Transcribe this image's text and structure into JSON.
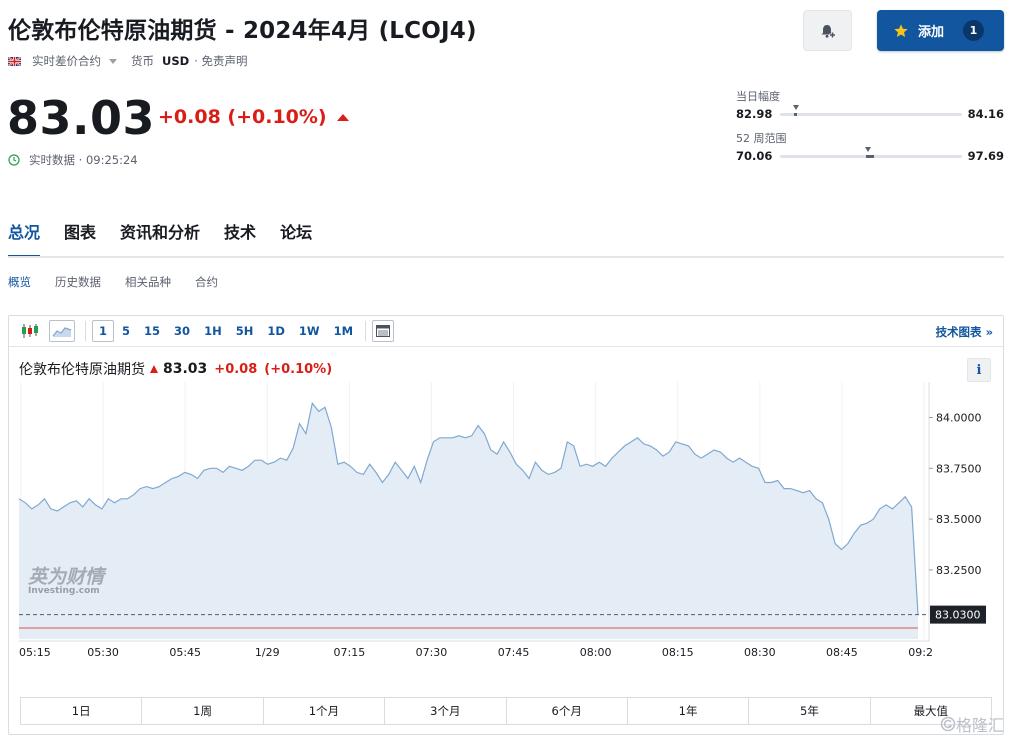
{
  "header": {
    "title": "伦敦布伦特原油期货 - 2024年4月 (LCOJ4)",
    "contract_type": "实时差价合约",
    "currency_label": "货币",
    "currency": "USD",
    "disclaimer": "· 免责声明",
    "alert_icon": "bell-plus-icon",
    "add_label": "添加",
    "add_count": "1"
  },
  "quote": {
    "price": "83.03",
    "change": "+0.08 (+0.10%)",
    "realtime_text": "实时数据 · 09:25:24"
  },
  "ranges": {
    "day_label": "当日幅度",
    "day_low": "82.98",
    "day_high": "84.16",
    "day_position": 0.04,
    "week52_label": "52 周范围",
    "week52_low": "70.06",
    "week52_high": "97.69",
    "week52_position": 0.47
  },
  "tabs": [
    "总况",
    "图表",
    "资讯和分析",
    "技术",
    "论坛"
  ],
  "subtabs": [
    "概览",
    "历史数据",
    "相关品种",
    "合约"
  ],
  "toolbar": {
    "intervals": [
      "1",
      "5",
      "15",
      "30",
      "1H",
      "5H",
      "1D",
      "1W",
      "1M"
    ],
    "active_interval": "1",
    "tech_chart_label": "技术图表 »"
  },
  "chart_header": {
    "name": "伦敦布伦特原油期货",
    "price": "83.03",
    "change": "+0.08",
    "change_pct": "(+0.10%)"
  },
  "chart_data": {
    "type": "area",
    "x_ticks": [
      "05:15",
      "05:30",
      "05:45",
      "1/29",
      "07:15",
      "07:30",
      "07:45",
      "08:00",
      "08:15",
      "08:30",
      "08:45",
      "09:2"
    ],
    "y_ticks": [
      "84.0000",
      "83.7500",
      "83.5000",
      "83.2500"
    ],
    "current_label": "83.0300",
    "ylim": [
      82.91,
      84.15
    ],
    "values": [
      83.6,
      83.58,
      83.55,
      83.57,
      83.6,
      83.55,
      83.54,
      83.56,
      83.58,
      83.59,
      83.56,
      83.6,
      83.57,
      83.55,
      83.6,
      83.58,
      83.6,
      83.6,
      83.62,
      83.65,
      83.66,
      83.65,
      83.66,
      83.68,
      83.7,
      83.71,
      83.73,
      83.72,
      83.7,
      83.74,
      83.75,
      83.75,
      83.73,
      83.76,
      83.75,
      83.74,
      83.76,
      83.79,
      83.79,
      83.77,
      83.78,
      83.8,
      83.79,
      83.85,
      83.97,
      83.92,
      84.07,
      84.03,
      84.05,
      83.95,
      83.77,
      83.78,
      83.76,
      83.73,
      83.72,
      83.77,
      83.73,
      83.68,
      83.72,
      83.78,
      83.74,
      83.7,
      83.76,
      83.68,
      83.79,
      83.88,
      83.9,
      83.9,
      83.9,
      83.91,
      83.9,
      83.91,
      83.96,
      83.92,
      83.84,
      83.82,
      83.88,
      83.83,
      83.77,
      83.74,
      83.7,
      83.78,
      83.74,
      83.72,
      83.73,
      83.75,
      83.88,
      83.86,
      83.76,
      83.77,
      83.76,
      83.78,
      83.76,
      83.8,
      83.83,
      83.86,
      83.88,
      83.9,
      83.87,
      83.86,
      83.84,
      83.81,
      83.83,
      83.88,
      83.87,
      83.86,
      83.82,
      83.8,
      83.82,
      83.84,
      83.83,
      83.8,
      83.78,
      83.8,
      83.78,
      83.76,
      83.75,
      83.68,
      83.68,
      83.69,
      83.65,
      83.65,
      83.64,
      83.63,
      83.64,
      83.6,
      83.58,
      83.5,
      83.38,
      83.35,
      83.38,
      83.43,
      83.47,
      83.48,
      83.5,
      83.55,
      83.57,
      83.55,
      83.58,
      83.61,
      83.56,
      83.03
    ],
    "xlabel": "",
    "ylabel": ""
  },
  "periods": [
    "1日",
    "1周",
    "1个月",
    "3个月",
    "6个月",
    "1年",
    "5年",
    "最大值"
  ],
  "watermark": {
    "main": "英为财情",
    "sub": "Investing.com"
  },
  "corner_mark": "格隆汇",
  "colors": {
    "accent": "#1256a0",
    "negative": "#d91e18",
    "chart_line": "#7fa8d1",
    "chart_fill": "#e4edf6"
  }
}
